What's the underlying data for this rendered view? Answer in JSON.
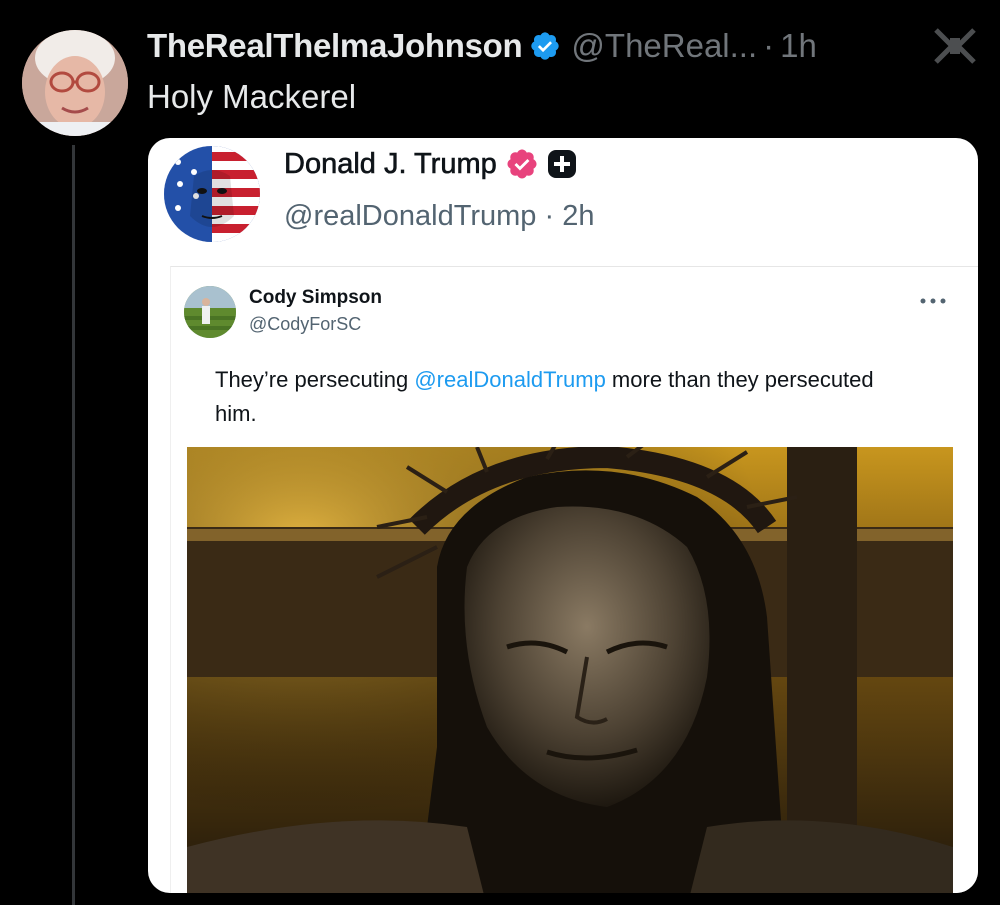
{
  "post": {
    "display_name": "TheRealThelmaJohnson",
    "handle": "@TheReal...",
    "separator": "·",
    "time": "1h",
    "text": "Holy Mackerel"
  },
  "quoted": {
    "display_name": "Donald J. Trump",
    "handle": "@realDonaldTrump",
    "separator": "·",
    "time": "2h",
    "inner": {
      "display_name": "Cody Simpson",
      "handle": "@CodyForSC",
      "text_before": "They’re persecuting ",
      "mention": "@realDonaldTrump",
      "text_after": " more than they persecuted him."
    }
  },
  "colors": {
    "background": "#000000",
    "verified_blue": "#1d9bf0",
    "pink_badge": "#e0245e",
    "mention_blue": "#1d9bf0"
  },
  "icons": {
    "verified": "verified-check-icon",
    "more": "more-icon",
    "pink_badge": "pink-verified-badge-icon",
    "plus": "plus-box-icon"
  }
}
